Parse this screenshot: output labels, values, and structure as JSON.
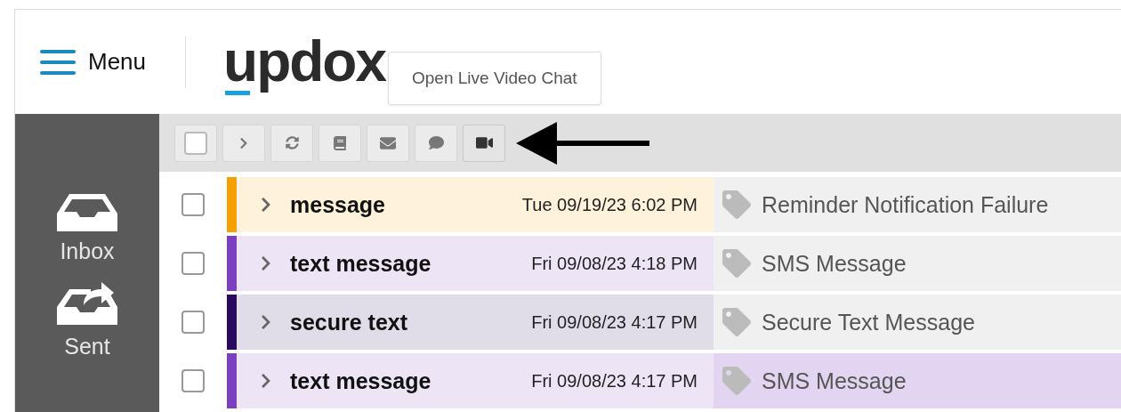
{
  "header": {
    "menu_label": "Menu",
    "logo": "updox"
  },
  "tooltip": "Open Live Video Chat",
  "toolbar": [
    {
      "kind": "checkbox",
      "hovered": false
    },
    {
      "kind": "chevron",
      "hovered": false
    },
    {
      "kind": "refresh",
      "hovered": false
    },
    {
      "kind": "book",
      "hovered": false
    },
    {
      "kind": "envelope",
      "hovered": false
    },
    {
      "kind": "chat",
      "hovered": false
    },
    {
      "kind": "video",
      "hovered": true
    }
  ],
  "sidebar": {
    "items": [
      {
        "kind": "inbox",
        "label": "Inbox"
      },
      {
        "kind": "sent",
        "label": "Sent"
      }
    ]
  },
  "messages": [
    {
      "checked": false,
      "color": "#f5a000",
      "title": "message",
      "date": "Tue 09/19/23 6:02 PM",
      "category": "Reminder Notification Failure",
      "highlighted": false
    },
    {
      "checked": false,
      "color": "#7b3fbf",
      "title": "text message",
      "date": "Fri 09/08/23 4:18 PM",
      "category": "SMS Message",
      "highlighted": false
    },
    {
      "checked": false,
      "color": "#2a0a5e",
      "title": "secure text",
      "date": "Fri 09/08/23 4:17 PM",
      "category": "Secure Text Message",
      "highlighted": false
    },
    {
      "checked": false,
      "color": "#7b3fbf",
      "title": "text message",
      "date": "Fri 09/08/23 4:17 PM",
      "category": "SMS Message",
      "highlighted": true
    }
  ]
}
